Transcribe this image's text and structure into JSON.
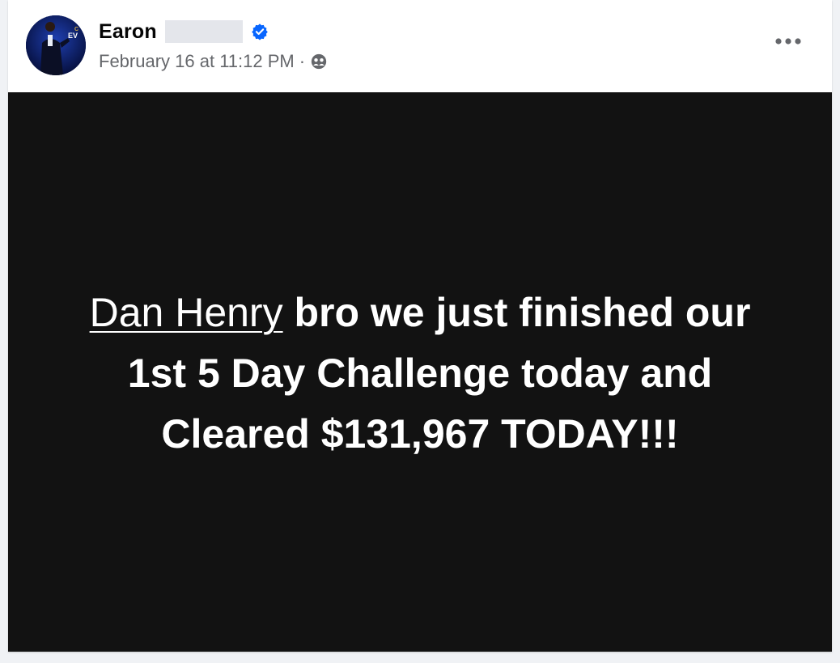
{
  "post": {
    "author": {
      "name": "Earon",
      "verified": true,
      "avatar_icon": "avatar-photo"
    },
    "meta": {
      "timestamp": "February 16 at 11:12 PM",
      "separator": "·",
      "audience_icon": "friends-audience-icon"
    },
    "more_icon": "more-options-icon",
    "body": {
      "mention": "Dan Henry",
      "text_part_1": " bro we just finished our",
      "text_part_2": "1st 5 Day Challenge today and",
      "text_part_3": "Cleared $131,967 TODAY!!!"
    },
    "colors": {
      "verified_blue": "#0866ff",
      "background_dark": "#121212",
      "meta_gray": "#65676b"
    }
  }
}
